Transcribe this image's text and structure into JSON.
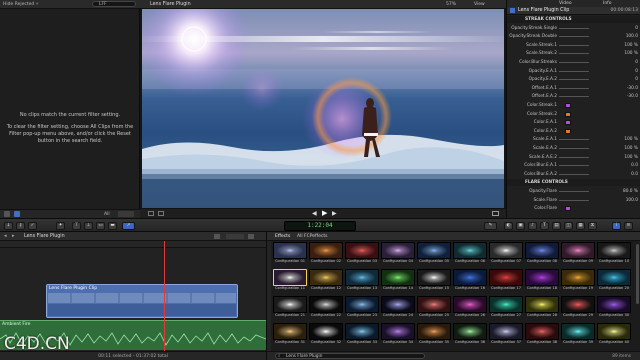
{
  "browser": {
    "filter_label": "Hide Rejected",
    "search_placeholder": "LFF",
    "empty_line1": "No clips match the current filter setting.",
    "empty_line2": "To clear the filter setting, choose All Clips from the Filter pop-up menu above, and/or click the Reset button in the search field.",
    "footer_filter": "All"
  },
  "viewer": {
    "title": "Lens Flare Plugin",
    "zoom": "57%",
    "view_menu": "View"
  },
  "inspector": {
    "tabs": [
      "Video",
      "Info"
    ],
    "clip_title": "Lens Flare Plugin Clip",
    "clip_time": "00:00:08:13",
    "rows": [
      {
        "label": "STREAK CONTROLS",
        "value": "",
        "kind": "section"
      },
      {
        "label": "Opacity.Streak.Single",
        "value": "0",
        "kind": "slider"
      },
      {
        "label": "Opacity.Streak.Double",
        "value": "100.0",
        "kind": "slider"
      },
      {
        "label": "Scale.Streak.1",
        "value": "100 %",
        "kind": "slider"
      },
      {
        "label": "Scale.Streak.2",
        "value": "100 %",
        "kind": "slider"
      },
      {
        "label": "Color.Blur.Streaks",
        "value": "0",
        "kind": "slider"
      },
      {
        "label": "Opacity.E.A.1",
        "value": "0",
        "kind": "slider"
      },
      {
        "label": "Opacity.E.A.2",
        "value": "0",
        "kind": "slider"
      },
      {
        "label": "Offset.E.A.1",
        "value": "-30.0",
        "kind": "slider"
      },
      {
        "label": "Offset.E.A.2",
        "value": "-30.0",
        "kind": "slider"
      },
      {
        "label": "Color.Streak.1",
        "value": "",
        "kind": "swatch",
        "color": "#b24fd6"
      },
      {
        "label": "Color.Streak.2",
        "value": "",
        "kind": "swatch",
        "color": "#e07a2a"
      },
      {
        "label": "Color.E.A.1",
        "value": "",
        "kind": "swatch",
        "color": "#b24fd6"
      },
      {
        "label": "Color.E.A.2",
        "value": "",
        "kind": "swatch",
        "color": "#e07a2a"
      },
      {
        "label": "Scale.E.A.1",
        "value": "100 %",
        "kind": "slider"
      },
      {
        "label": "Scale.E.A.2",
        "value": "100 %",
        "kind": "slider"
      },
      {
        "label": "Scale.E.A.E.2",
        "value": "100 %",
        "kind": "slider"
      },
      {
        "label": "Color.Blur.E.A.1",
        "value": "0.0",
        "kind": "slider"
      },
      {
        "label": "Color.Blur.E.A.2",
        "value": "0.0",
        "kind": "slider"
      },
      {
        "label": "FLARE CONTROLS",
        "value": "",
        "kind": "section"
      },
      {
        "label": "Opacity.Flare",
        "value": "80.0 %",
        "kind": "slider"
      },
      {
        "label": "Scale.Flare",
        "value": "100.0",
        "kind": "slider"
      },
      {
        "label": "Color.Flare",
        "value": "",
        "kind": "swatch",
        "color": "#b24fd6"
      }
    ]
  },
  "toolbar": {
    "timecode": "1:22:04",
    "zoom_readout": "100"
  },
  "timeline": {
    "project_name": "Lens Flare Plugin",
    "clip_label": "Lens Flare Plugin Clip",
    "audio_label": "Ambient Fire",
    "footer": "00:11 selected - 01:37:02 total"
  },
  "effects": {
    "title": "Effects",
    "subtitle": "All FCPeffects",
    "search_value": "Lens Flare Plugin",
    "count": "89 items",
    "tiles": [
      {
        "label": "Configuration 01",
        "bg": "#2a3050",
        "glow": "#b7c5ff"
      },
      {
        "label": "Configuration 02",
        "bg": "#3a1e10",
        "glow": "#ff9a3a"
      },
      {
        "label": "Configuration 03",
        "bg": "#3a0f12",
        "glow": "#ff5a5a"
      },
      {
        "label": "Configuration 04",
        "bg": "#2a1f3a",
        "glow": "#e4b0ff"
      },
      {
        "label": "Configuration 05",
        "bg": "#10203a",
        "glow": "#7fb8ff"
      },
      {
        "label": "Configuration 06",
        "bg": "#0f2a30",
        "glow": "#5fe0e8"
      },
      {
        "label": "Configuration 07",
        "bg": "#2a2a2a",
        "glow": "#ffffff"
      },
      {
        "label": "Configuration 08",
        "bg": "#101a3a",
        "glow": "#6f8cff"
      },
      {
        "label": "Configuration 09",
        "bg": "#301a2a",
        "glow": "#ff8ad0"
      },
      {
        "label": "Configuration 10",
        "bg": "#181818",
        "glow": "#d0d0d0"
      },
      {
        "label": "Configuration 11",
        "bg": "#2a1a30",
        "glow": "#ffffff"
      },
      {
        "label": "Configuration 12",
        "bg": "#3a2a10",
        "glow": "#ffd05a"
      },
      {
        "label": "Configuration 13",
        "bg": "#102a3a",
        "glow": "#5ac8ff"
      },
      {
        "label": "Configuration 14",
        "bg": "#103010",
        "glow": "#7aff6a"
      },
      {
        "label": "Configuration 15",
        "bg": "#1a1a1a",
        "glow": "#ffffff"
      },
      {
        "label": "Configuration 16",
        "bg": "#0a1a3a",
        "glow": "#3a7aff"
      },
      {
        "label": "Configuration 17",
        "bg": "#3a0a0a",
        "glow": "#ff3a3a"
      },
      {
        "label": "Configuration 18",
        "bg": "#2a0a3a",
        "glow": "#c03aff"
      },
      {
        "label": "Configuration 19",
        "bg": "#3a2a0a",
        "glow": "#ffb02a"
      },
      {
        "label": "Configuration 20",
        "bg": "#0a2a3a",
        "glow": "#3ad0ff"
      },
      {
        "label": "Configuration 21",
        "bg": "#1a1a1a",
        "glow": "#ffffff"
      },
      {
        "label": "Configuration 22",
        "bg": "#0a0a0a",
        "glow": "#dddddd"
      },
      {
        "label": "Configuration 23",
        "bg": "#0a1a30",
        "glow": "#8ac0ff"
      },
      {
        "label": "Configuration 24",
        "bg": "#0a0a1a",
        "glow": "#aaaaff"
      },
      {
        "label": "Configuration 25",
        "bg": "#301010",
        "glow": "#ff7a7a"
      },
      {
        "label": "Configuration 26",
        "bg": "#2a0a2a",
        "glow": "#ff5ae0"
      },
      {
        "label": "Configuration 27",
        "bg": "#0a302a",
        "glow": "#3affd0"
      },
      {
        "label": "Configuration 28",
        "bg": "#30300a",
        "glow": "#ffff5a"
      },
      {
        "label": "Configuration 29",
        "bg": "#101010",
        "glow": "#ff5a5a"
      },
      {
        "label": "Configuration 30",
        "bg": "#1a0a2a",
        "glow": "#a05aff"
      },
      {
        "label": "Configuration 31",
        "bg": "#2a200a",
        "glow": "#ffd080"
      },
      {
        "label": "Configuration 32",
        "bg": "#0a0a0a",
        "glow": "#ffffff"
      },
      {
        "label": "Configuration 33",
        "bg": "#0a1a2a",
        "glow": "#7fd0ff"
      },
      {
        "label": "Configuration 34",
        "bg": "#1a102a",
        "glow": "#c080ff"
      },
      {
        "label": "Configuration 35",
        "bg": "#2a1a0a",
        "glow": "#ffa050"
      },
      {
        "label": "Configuration 36",
        "bg": "#101a10",
        "glow": "#a0ffa0"
      },
      {
        "label": "Configuration 37",
        "bg": "#1a1a2a",
        "glow": "#d0d0ff"
      },
      {
        "label": "Configuration 38",
        "bg": "#2a0a0a",
        "glow": "#ff6060"
      },
      {
        "label": "Configuration 39",
        "bg": "#0a2a2a",
        "glow": "#60ffff"
      },
      {
        "label": "Configuration 40",
        "bg": "#2a2a0a",
        "glow": "#ffff90"
      }
    ]
  },
  "watermark": "C4D.CN"
}
